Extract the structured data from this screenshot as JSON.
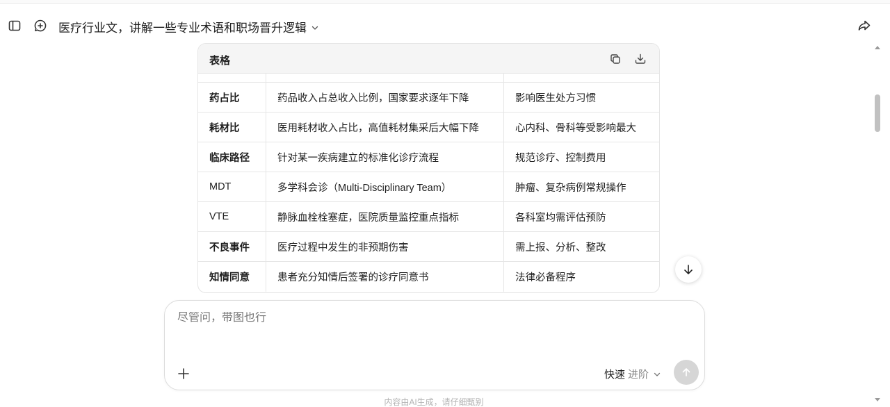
{
  "header": {
    "sidebar_icon": "sidebar-toggle-icon",
    "new_chat_icon": "new-chat-icon",
    "title": "医疗行业文，讲解一些专业术语和职场晋升逻辑",
    "share_icon": "share-icon"
  },
  "table": {
    "label": "表格",
    "copy_icon": "copy-icon",
    "download_icon": "download-icon",
    "rows": [
      {
        "term": "药占比",
        "desc": "药品收入占总收入比例，国家要求逐年下降",
        "note": "影响医生处方习惯"
      },
      {
        "term": "耗材比",
        "desc": "医用耗材收入占比，高值耗材集采后大幅下降",
        "note": "心内科、骨科等受影响最大"
      },
      {
        "term": "临床路径",
        "desc": "针对某一疾病建立的标准化诊疗流程",
        "note": "规范诊疗、控制费用"
      },
      {
        "term": "MDT",
        "desc": "多学科会诊（Multi-Disciplinary Team）",
        "note": "肿瘤、复杂病例常规操作"
      },
      {
        "term": "VTE",
        "desc": "静脉血栓栓塞症，医院质量监控重点指标",
        "note": "各科室均需评估预防"
      },
      {
        "term": "不良事件",
        "desc": "医疗过程中发生的非预期伤害",
        "note": "需上报、分析、整改"
      },
      {
        "term": "知情同意",
        "desc": "患者充分知情后签署的诊疗同意书",
        "note": "法律必备程序"
      }
    ]
  },
  "composer": {
    "placeholder": "尽管问，带图也行",
    "mode_fast": "快速",
    "mode_advanced": "进阶"
  },
  "footer": {
    "note": "内容由AI生成，请仔细甄别"
  },
  "colors": {
    "send_disabled": "#d6d6d6",
    "table_header_bg": "#f5f5f5",
    "border": "#e6e6e6"
  }
}
